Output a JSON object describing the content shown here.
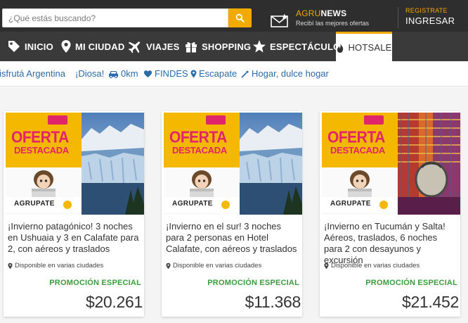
{
  "header": {
    "search_placeholder": "¿Qué estás buscando?",
    "news_brand_a": "AGRU",
    "news_brand_b": "NEWS",
    "news_sub": "Recibí las mejores ofertas",
    "register_label": "REGISTRATE",
    "login_label": "INGRESAR"
  },
  "nav": {
    "items": [
      {
        "label": "INICIO",
        "icon": "tag-icon"
      },
      {
        "label": "MI CIUDAD",
        "icon": "pin-icon"
      },
      {
        "label": "VIAJES",
        "icon": "plane-icon"
      },
      {
        "label": "SHOPPING",
        "icon": "gift-icon"
      },
      {
        "label": "ESPECTÁCULOS",
        "icon": "star-icon"
      },
      {
        "label": "HOTSALE",
        "icon": "flame-icon"
      }
    ],
    "active": "HOTSALE"
  },
  "subnav": {
    "items": [
      {
        "label": "isfrutá Argentina"
      },
      {
        "label": "¡Diosa!"
      },
      {
        "label": "0km",
        "icon": "car-icon"
      },
      {
        "label": "FINDES",
        "icon": "heart-icon"
      },
      {
        "label": "Escapate",
        "icon": "pin-icon"
      },
      {
        "label": "Hogar, dulce hogar",
        "icon": "wand-icon"
      }
    ]
  },
  "cards": [
    {
      "banner_line1": "OFERTA",
      "banner_line2": "DESTACADA",
      "banner_brand": "AGRUPATE",
      "title": "¡Invierno patagónico! 3 noches en Ushuaia y 3 en Calafate para 2, con aéreos y traslados",
      "location": "Disponible en varias ciudades",
      "promo": "PROMOCIÓN ESPECIAL",
      "price": "$20.261"
    },
    {
      "banner_line1": "OFERTA",
      "banner_line2": "DESTACADA",
      "banner_brand": "AGRUPATE",
      "title": "¡Invierno en el sur! 3 noches para 2 personas en Hotel Calafate, con aéreos y traslados",
      "location": "Disponible en varias ciudades",
      "promo": "PROMOCIÓN ESPECIAL",
      "price": "$11.368"
    },
    {
      "banner_line1": "OFERTA",
      "banner_line2": "DESTACADA",
      "banner_brand": "AGRUPATE",
      "title": "¡Invierno en Tucumán y Salta! Aéreos, traslados, 6 noches para 2 con desayunos y excursión",
      "location": "Disponible en varias ciudades",
      "promo": "PROMOCIÓN ESPECIAL",
      "price": "$21.452"
    }
  ],
  "colors": {
    "accent": "#f2a900",
    "topbar": "#2e2e2e",
    "nav": "#3a3a3a",
    "link": "#2b6ba8",
    "promo": "#3b9c3b",
    "banner_pink": "#e0256b"
  }
}
